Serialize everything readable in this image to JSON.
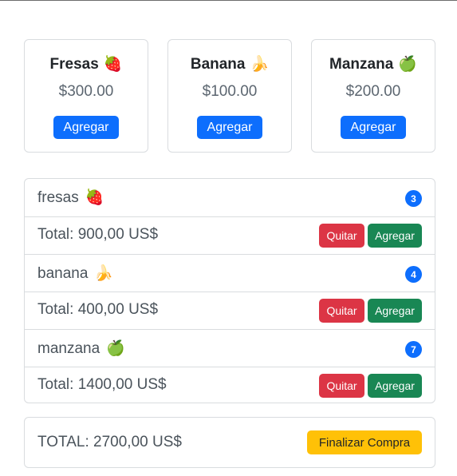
{
  "products": [
    {
      "name": "Fresas",
      "emoji": "🍓",
      "price": "$300.00",
      "button": "Agregar"
    },
    {
      "name": "Banana",
      "emoji": "🍌",
      "price": "$100.00",
      "button": "Agregar"
    },
    {
      "name": "Manzana",
      "emoji": "🍏",
      "price": "$200.00",
      "button": "Agregar"
    }
  ],
  "cart": {
    "items": [
      {
        "name": "fresas",
        "emoji": "🍓",
        "quantity": "3",
        "total": "Total: 900,00 US$",
        "remove_label": "Quitar",
        "add_label": "Agregar"
      },
      {
        "name": "banana",
        "emoji": "🍌",
        "quantity": "4",
        "total": "Total: 400,00 US$",
        "remove_label": "Quitar",
        "add_label": "Agregar"
      },
      {
        "name": "manzana",
        "emoji": "🍏",
        "quantity": "7",
        "total": "Total: 1400,00 US$",
        "remove_label": "Quitar",
        "add_label": "Agregar"
      }
    ],
    "grand_total": "TOTAL: 2700,00 US$",
    "checkout_label": "Finalizar Compra"
  },
  "colors": {
    "primary": "#0d6efd",
    "danger": "#dc3545",
    "success": "#198754",
    "warning": "#ffc107",
    "border": "#d9dcdf"
  }
}
